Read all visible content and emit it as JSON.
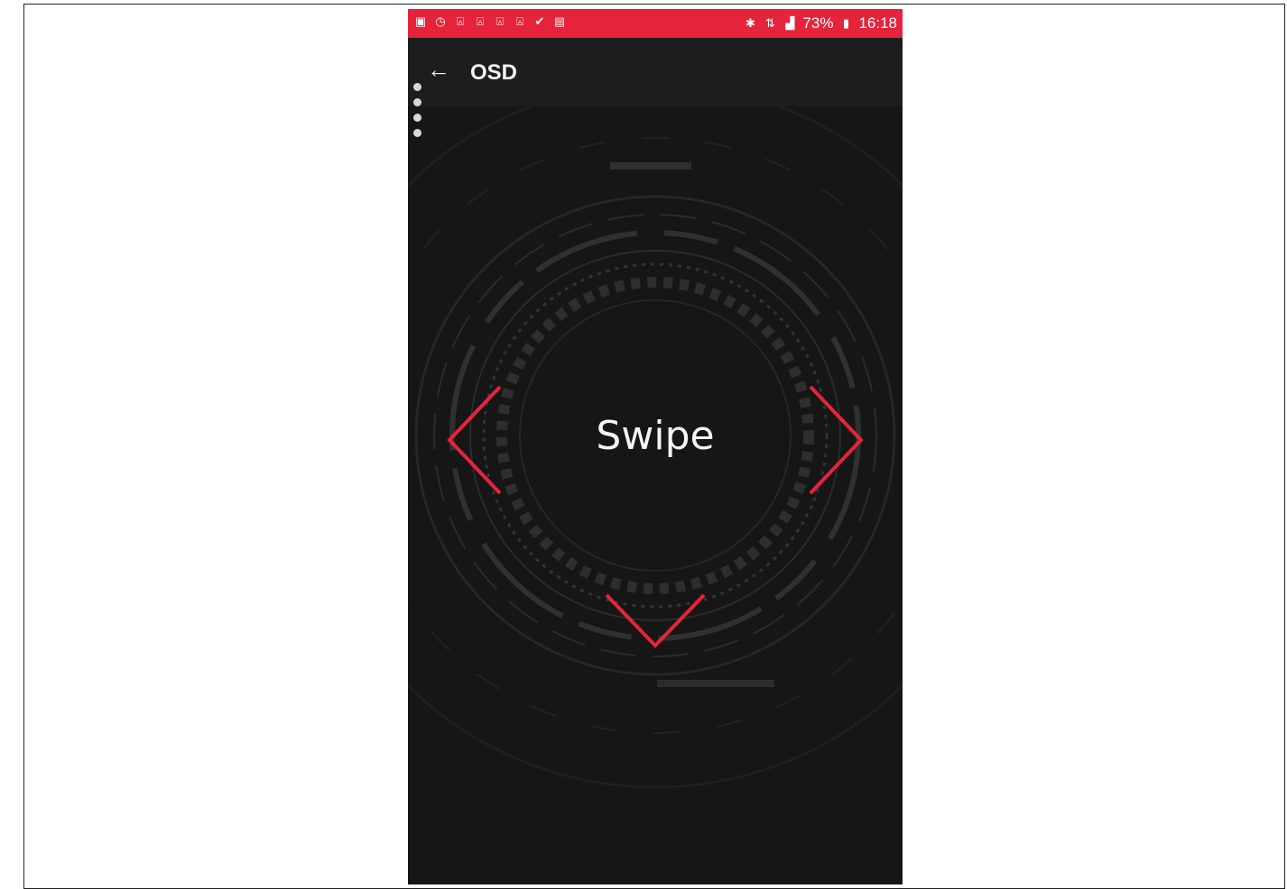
{
  "statusbar": {
    "left_icons": [
      "notification-icon",
      "clock-icon",
      "lock-icon",
      "lock-icon",
      "lock-icon",
      "lock-icon",
      "check-icon",
      "image-icon"
    ],
    "battery_percent": "73%",
    "time": "16:18"
  },
  "appbar": {
    "title": "OSD"
  },
  "main": {
    "swipe_label": "Swipe"
  },
  "colors": {
    "accent": "#e5243b",
    "background": "#161616"
  }
}
